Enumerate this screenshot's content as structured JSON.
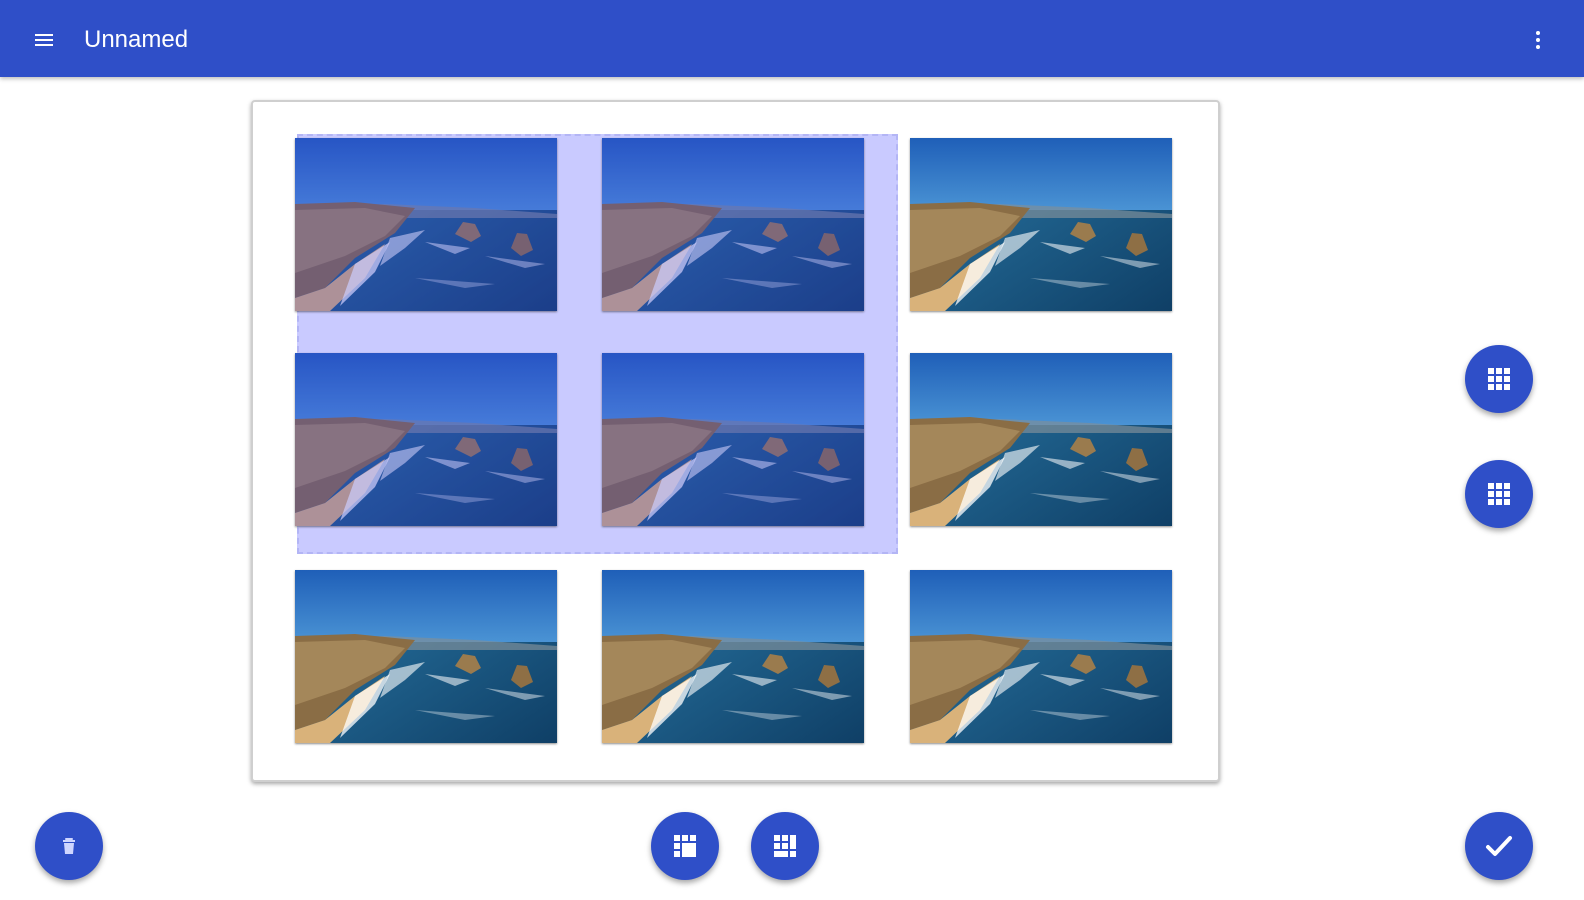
{
  "appbar": {
    "title": "Unnamed",
    "background_color": "#2f4fc8",
    "menu_icon": "hamburger-menu-icon",
    "overflow_icon": "more-vert-icon"
  },
  "grid": {
    "rows": 3,
    "columns": 3,
    "selection_color": "#c9caff",
    "photos": [
      {
        "selected": true
      },
      {
        "selected": true
      },
      {
        "selected": false
      },
      {
        "selected": true
      },
      {
        "selected": true
      },
      {
        "selected": false
      },
      {
        "selected": false
      },
      {
        "selected": false
      },
      {
        "selected": false
      }
    ]
  },
  "actions": {
    "side_top_icon": "grid-3x3-icon",
    "side_bottom_icon": "grid-3x3-icon",
    "bottom_left_icon": "delete-icon",
    "bottom_center_left_icon": "grid-merge-icon",
    "bottom_center_right_icon": "grid-split-icon",
    "bottom_right_icon": "check-icon"
  }
}
